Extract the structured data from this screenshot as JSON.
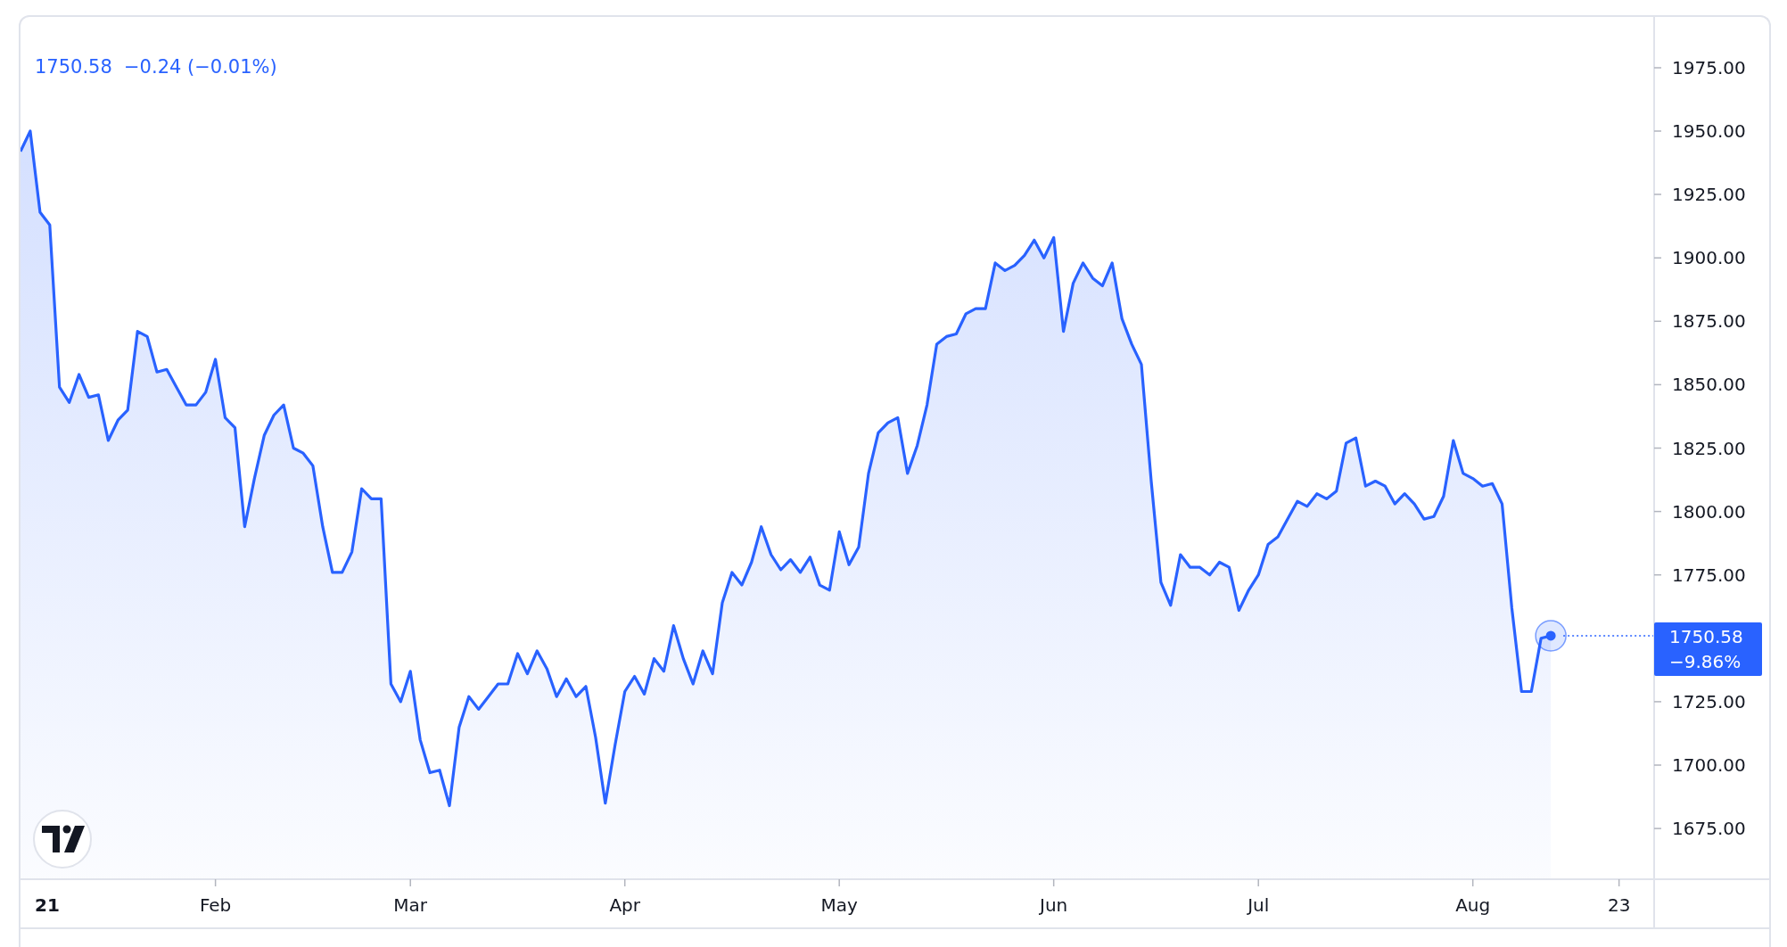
{
  "legend": {
    "price": "1750.58",
    "change": "−0.24 (−0.01%)"
  },
  "last_price_tag": {
    "price": "1750.58",
    "change_percent": "−9.86%"
  },
  "chart": {
    "year_label": "21",
    "chart_data": {
      "type": "area",
      "ylim": [
        1655,
        1995
      ],
      "categories": [
        null,
        null,
        null,
        null,
        null,
        null,
        null,
        null,
        null,
        null,
        null,
        null,
        null,
        null,
        null,
        null,
        null,
        null,
        null,
        null,
        "Feb",
        null,
        null,
        null,
        null,
        null,
        null,
        null,
        null,
        null,
        null,
        null,
        null,
        null,
        null,
        null,
        null,
        null,
        null,
        null,
        "Mar",
        null,
        null,
        null,
        null,
        null,
        null,
        null,
        null,
        null,
        null,
        null,
        null,
        null,
        null,
        null,
        null,
        null,
        null,
        null,
        null,
        null,
        "Apr",
        null,
        null,
        null,
        null,
        null,
        null,
        null,
        null,
        null,
        null,
        null,
        null,
        null,
        null,
        null,
        null,
        null,
        null,
        null,
        null,
        null,
        "May",
        null,
        null,
        null,
        null,
        null,
        null,
        null,
        null,
        null,
        null,
        null,
        null,
        null,
        null,
        null,
        null,
        null,
        null,
        null,
        null,
        null,
        "Jun",
        null,
        null,
        null,
        null,
        null,
        null,
        null,
        null,
        null,
        null,
        null,
        null,
        null,
        null,
        null,
        null,
        null,
        null,
        null,
        null,
        "Jul",
        null,
        null,
        null,
        null,
        null,
        null,
        null,
        null,
        null,
        null,
        null,
        null,
        null,
        null,
        null,
        null,
        null,
        null,
        null,
        null,
        null,
        "Aug",
        null,
        null,
        null,
        null,
        null,
        null,
        null,
        null,
        null,
        null,
        null,
        null,
        null,
        null,
        "23",
        null,
        null,
        null
      ],
      "series": [
        {
          "color": "#2962ff",
          "values": [
            1942,
            1950,
            1918,
            1913,
            1849,
            1843,
            1854,
            1845,
            1846,
            1828,
            1836,
            1840,
            1871,
            1869,
            1855,
            1856,
            1849,
            1842,
            1842,
            1847,
            1860,
            1837,
            1833,
            1794,
            1813,
            1830,
            1838,
            1842,
            1825,
            1823,
            1818,
            1794,
            1776,
            1776,
            1784,
            1809,
            1805,
            1805,
            1732,
            1725,
            1737,
            1710,
            1697,
            1698,
            1684,
            1715,
            1727,
            1722,
            1727,
            1732,
            1732,
            1744,
            1736,
            1745,
            1738,
            1727,
            1734,
            1727,
            1731,
            1711,
            1685,
            1708,
            1729,
            1735,
            1728,
            1742,
            1737,
            1755,
            1742,
            1732,
            1745,
            1736,
            1764,
            1776,
            1771,
            1780,
            1794,
            1783,
            1777,
            1781,
            1776,
            1782,
            1771,
            1769,
            1792,
            1779,
            1786,
            1815,
            1831,
            1835,
            1837,
            1815,
            1826,
            1842,
            1866,
            1869,
            1870,
            1878,
            1880,
            1880,
            1898,
            1895,
            1897,
            1901,
            1907,
            1900,
            1908,
            1871,
            1890,
            1898,
            1892,
            1889,
            1898,
            1876,
            1866,
            1858,
            1812,
            1772,
            1763,
            1783,
            1778,
            1778,
            1775,
            1780,
            1778,
            1761,
            1769,
            1775,
            1787,
            1790,
            1797,
            1804,
            1802,
            1807,
            1805,
            1808,
            1827,
            1829,
            1810,
            1812,
            1810,
            1803,
            1807,
            1803,
            1797,
            1798,
            1806,
            1828,
            1815,
            1813,
            1810,
            1811,
            1803,
            1762,
            1729,
            1729,
            1750,
            1751,
            null,
            null,
            null,
            null,
            null,
            null,
            null,
            null,
            null,
            null
          ]
        }
      ],
      "yticks": [
        {
          "value": 1675,
          "label": "1675.00"
        },
        {
          "value": 1700,
          "label": "1700.00"
        },
        {
          "value": 1725,
          "label": "1725.00"
        },
        {
          "value": 1775,
          "label": "1775.00"
        },
        {
          "value": 1800,
          "label": "1800.00"
        },
        {
          "value": 1825,
          "label": "1825.00"
        },
        {
          "value": 1850,
          "label": "1850.00"
        },
        {
          "value": 1875,
          "label": "1875.00"
        },
        {
          "value": 1900,
          "label": "1900.00"
        },
        {
          "value": 1925,
          "label": "1925.00"
        },
        {
          "value": 1950,
          "label": "1950.00"
        },
        {
          "value": 1975,
          "label": "1975.00"
        }
      ]
    }
  }
}
